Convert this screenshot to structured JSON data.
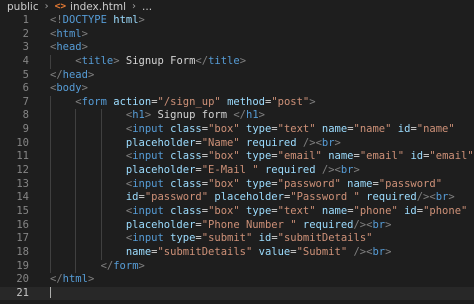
{
  "breadcrumb": {
    "folder": "public",
    "icon_text": "<>",
    "file": "index.html",
    "more": "..."
  },
  "lines": [
    {
      "n": "1",
      "indent": 0,
      "code": "<!DOCTYPE html>"
    },
    {
      "n": "2",
      "indent": 0,
      "code": "<html>"
    },
    {
      "n": "3",
      "indent": 0,
      "code": "<head>"
    },
    {
      "n": "4",
      "indent": 1,
      "code": "<title> Signup Form</title>"
    },
    {
      "n": "5",
      "indent": 0,
      "code": "</head>"
    },
    {
      "n": "6",
      "indent": 0,
      "code": "<body>"
    },
    {
      "n": "7",
      "indent": 1,
      "code": "<form action=\"/sign_up\" method=\"post\">"
    },
    {
      "n": "8",
      "indent": 3,
      "code": "<h1> Signup form </h1>"
    },
    {
      "n": "9",
      "indent": 3,
      "code": "<input class=\"box\" type=\"text\" name=\"name\" id=\"name\""
    },
    {
      "n": "10",
      "indent": 3,
      "code": "placeholder=\"Name\" required /><br>"
    },
    {
      "n": "11",
      "indent": 3,
      "code": "<input class=\"box\" type=\"email\" name=\"email\" id=\"email\""
    },
    {
      "n": "12",
      "indent": 3,
      "code": "placeholder=\"E-Mail \" required /><br>"
    },
    {
      "n": "13",
      "indent": 3,
      "code": "<input class=\"box\" type=\"password\" name=\"password\""
    },
    {
      "n": "14",
      "indent": 3,
      "code": "id=\"password\" placeholder=\"Password \" required/><br>"
    },
    {
      "n": "15",
      "indent": 3,
      "code": "<input class=\"box\" type=\"text\" name=\"phone\" id=\"phone\""
    },
    {
      "n": "16",
      "indent": 3,
      "code": "placeholder=\"Phone Number \" required/><br>"
    },
    {
      "n": "17",
      "indent": 3,
      "code": "<input type=\"submit\" id=\"submitDetails\""
    },
    {
      "n": "18",
      "indent": 3,
      "code": "name=\"submitDetails\" value=\"Submit\" /><br>"
    },
    {
      "n": "19",
      "indent": 2,
      "code": "</form>"
    },
    {
      "n": "20",
      "indent": 0,
      "code": "</html>"
    },
    {
      "n": "21",
      "indent": 0,
      "code": "",
      "active": true
    }
  ],
  "colors": {
    "background": "#1e1e1e",
    "tag": "#569cd6",
    "attribute": "#9cdcfe",
    "string": "#ce9178",
    "bracket": "#808080",
    "text": "#d4d4d4",
    "line_number": "#858585",
    "html_icon": "#e37933"
  }
}
